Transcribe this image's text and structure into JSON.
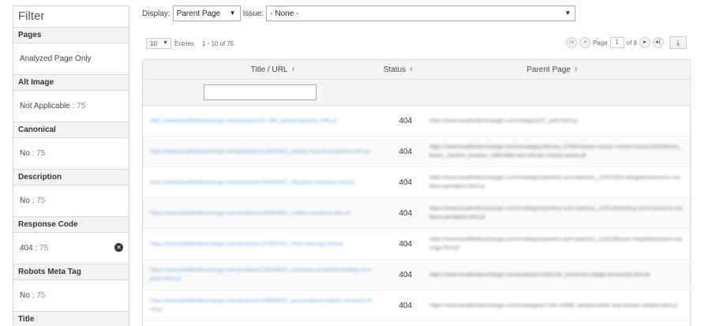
{
  "filter": {
    "title": "Filter",
    "sections": [
      {
        "heading": "Pages",
        "value": "Analyzed Page Only",
        "count": ""
      },
      {
        "heading": "Alt Image",
        "value": "Not Applicable",
        "count": "75"
      },
      {
        "heading": "Canonical",
        "value": "No",
        "count": "75"
      },
      {
        "heading": "Description",
        "value": "No",
        "count": "75"
      },
      {
        "heading": "Response Code",
        "value": "404",
        "count": "75"
      },
      {
        "heading": "Robots Meta Tag",
        "value": "No",
        "count": "75"
      },
      {
        "heading": "Title",
        "value": "",
        "count": ""
      }
    ],
    "clear_glyph": "✕"
  },
  "toolbar": {
    "display_label": "Display:",
    "display_value": "Parent Page",
    "issue_label": "Issue:",
    "issue_value": "- None -"
  },
  "pagination": {
    "page_size": "10",
    "entries_label": "Entries",
    "range_text": "1 - 10 of 75",
    "page_label": "Page",
    "current_page": "1",
    "of_text": "of 8",
    "export_icon": "download-icon"
  },
  "table": {
    "columns": [
      "Title / URL",
      "Status",
      "Parent Page"
    ],
    "rows": [
      {
        "url": "https://www.bradfordexchange.com/category/97-486_pets/ornaments.html.pl",
        "status": "404",
        "parent": "https://www.bradfordexchange.com/category/97_pets.html.pl"
      },
      {
        "url": "https://www.bradfordexchange.com/products/113073001_mickey-mouse-ornament.html.pl",
        "status": "404",
        "parent": "https://www.bradfordexchange.com/mcategory/disney_9788/mickey-mouse-minnie-mouse.html/disney_bears_1/action_product_collectible-sets-disney-mickey-action.pl"
      },
      {
        "url": "https://www.bradfordexchange.com/products/106840001_daughter-necklace.html.pl",
        "status": "404",
        "parent": "https://www.bradfordexchange.com/mcategory/jewelry-and-watches_120518/for-daughter/womens-necklace-pendants.html.pl"
      },
      {
        "url": "https://www.bradfordexchange.com/products/105462001_mother-necklace.html.pl",
        "status": "404",
        "parent": "https://www.bradfordexchange.com/mcategory/jewelry-and-watches_120518/sterling-silver/womens-necklace-pendants.html.pl"
      },
      {
        "url": "https://www.bradfordexchange.com/products/107641001_mom-earrings.html.pl",
        "status": "404",
        "parent": "https://www.bradfordexchange.com/mcategory/jewelry-and-watches_120518/heart-shaped/womens-earrings.html.pl"
      },
      {
        "url": "https://www.bradfordexchange.com/products/118108001_christmas-ornament-holiday-sculpture.html.pl",
        "status": "404",
        "parent": "https://www.bradfordexchange.com/products/1000108_christmas-village-accessory.html.pl"
      },
      {
        "url": "https://www.bradfordexchange.com/products/106690001_personalized-mother-necklace.html.pl",
        "status": "404",
        "parent": "https://www.bradfordexchange.com/mcategory/1254-10098_family/mother-and-women-jewelry.html.pl"
      }
    ]
  }
}
